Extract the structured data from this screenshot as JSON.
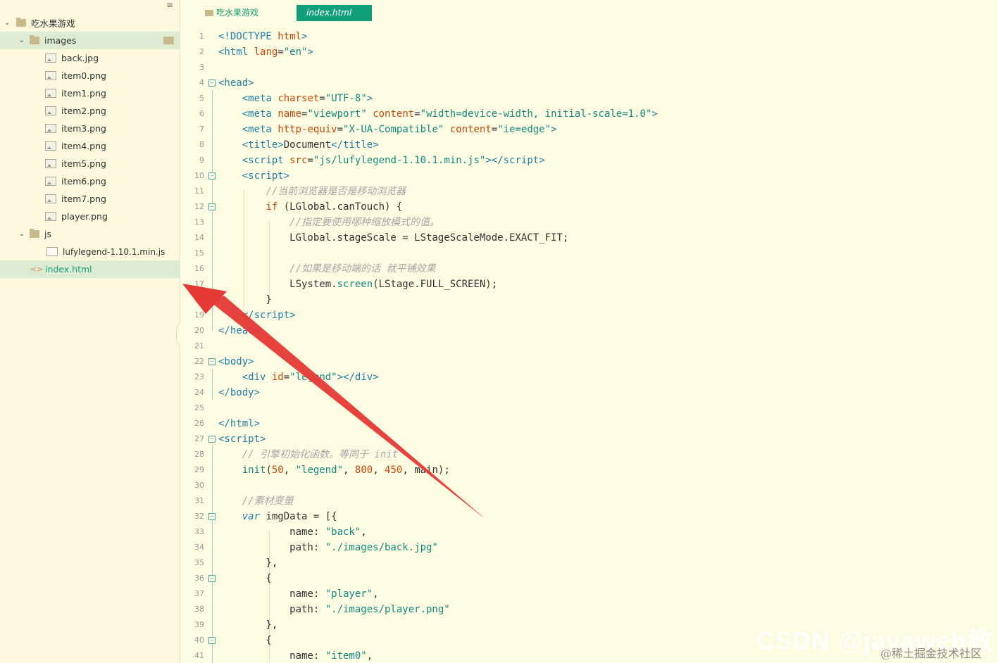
{
  "sidebar": {
    "project": "吃水果游戏",
    "images_folder": "images",
    "images": [
      "back.jpg",
      "item0.png",
      "item1.png",
      "item2.png",
      "item3.png",
      "item4.png",
      "item5.png",
      "item6.png",
      "item7.png",
      "player.png"
    ],
    "js_folder": "js",
    "js_files": [
      "lufylegend-1.10.1.min.js"
    ],
    "root_file": "index.html",
    "collapse_glyph": "‹",
    "menu_glyph": "≡"
  },
  "tabs": {
    "folder_label": "吃水果游戏",
    "active_label": "index.html"
  },
  "watermark": {
    "csdn": "CSDN @javaweb教程",
    "juejin": "@稀土掘金技术社区"
  },
  "colors": {
    "background": "#fdfbe2",
    "accent": "#11a079",
    "arrow": "#e53935"
  }
}
